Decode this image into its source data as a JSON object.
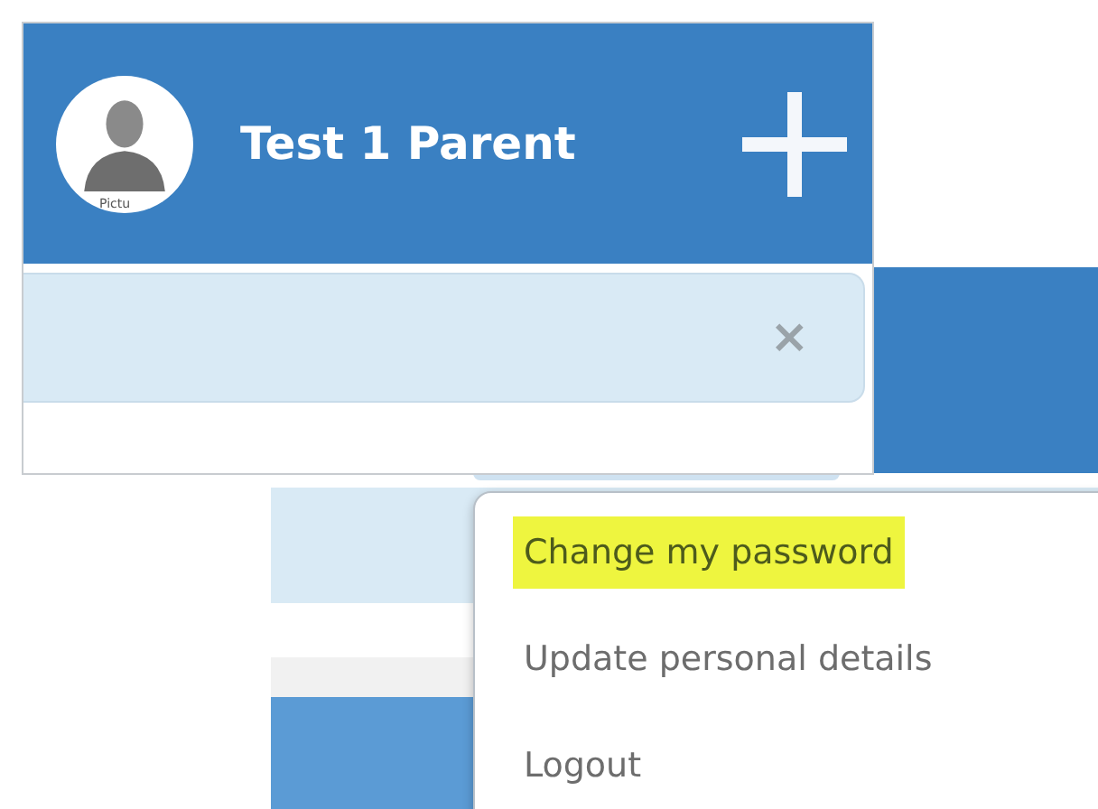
{
  "front_screen": {
    "user_name": "Test 1 Parent",
    "avatar_caption": "Pictu",
    "alert": {
      "close": "×"
    }
  },
  "user_menu": [
    {
      "label": "Change my password",
      "selected": true
    },
    {
      "label": "Update personal details",
      "selected": false
    },
    {
      "label": "Logout",
      "selected": false
    }
  ]
}
